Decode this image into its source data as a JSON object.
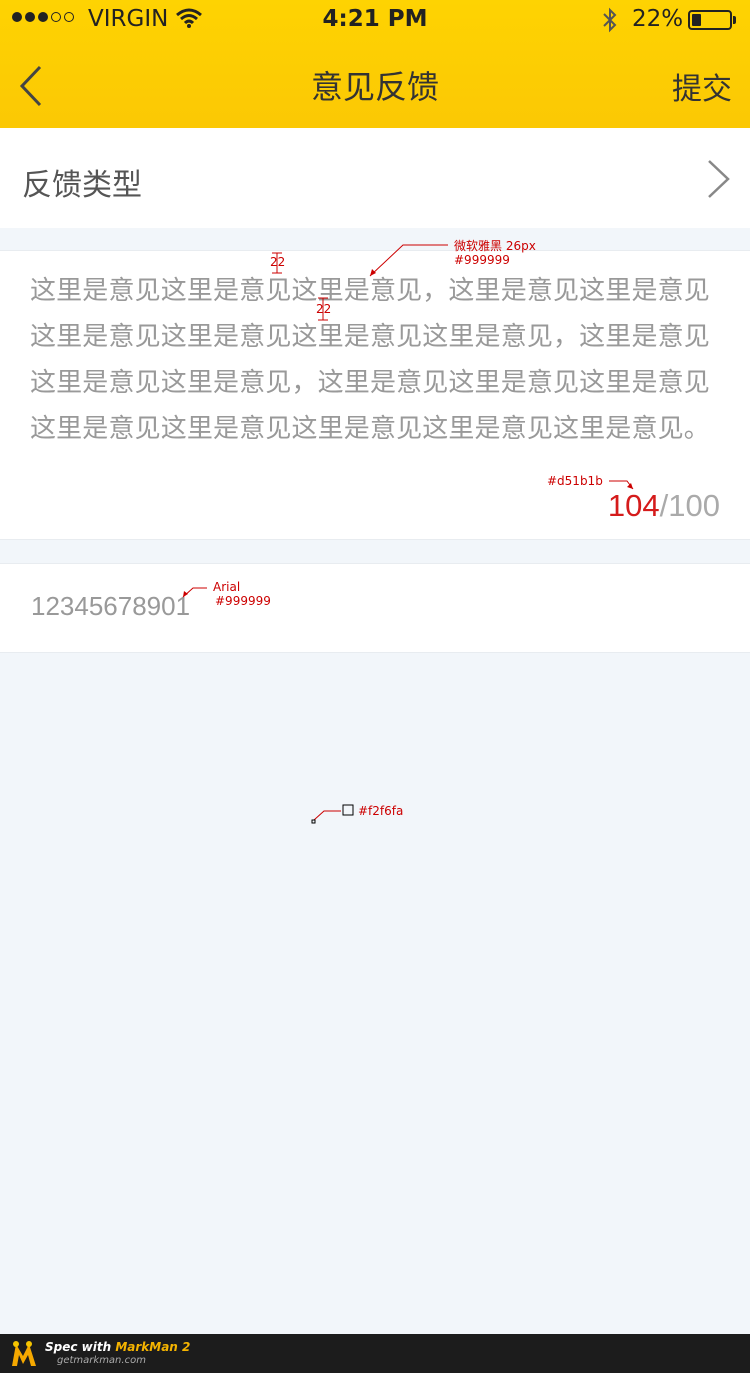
{
  "status_bar": {
    "carrier": "VIRGIN",
    "time": "4:21 PM",
    "battery": "22%"
  },
  "nav": {
    "title": "意见反馈",
    "submit": "提交"
  },
  "feedback_type": {
    "label": "反馈类型"
  },
  "feedback": {
    "text": "这里是意见这里是意见这里是意见，这里是意见这里是意见\n这里是意见这里是意见这里是意见这里是意见，这里是意见\n这里是意见这里是意见，这里是意见这里是意见这里是意见\n这里是意见这里是意见这里是意见这里是意见这里是意见。",
    "count_current": "104",
    "count_separator": "/",
    "count_max": "100"
  },
  "contact": {
    "value": "12345678901"
  },
  "annotations": {
    "font_spec_name": "微软雅黑 26px",
    "font_spec_color": "#999999",
    "spacing_top": "22",
    "spacing_line": "22",
    "counter_color": "#d51b1b",
    "contact_font": "Arial",
    "contact_color": "#999999",
    "bg_color": "#f2f6fa"
  },
  "footer": {
    "brand_prefix": "Spec with ",
    "brand_name": "MarkMan 2",
    "url": "getmarkman.com"
  }
}
